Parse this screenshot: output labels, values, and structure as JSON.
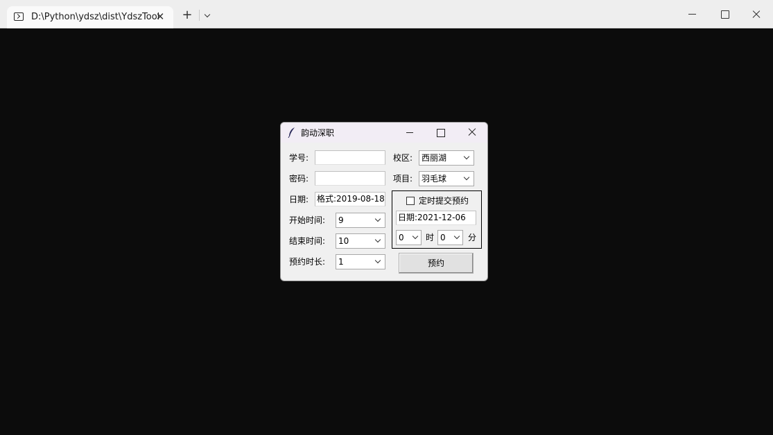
{
  "terminal": {
    "tab_title": "D:\\Python\\ydsz\\dist\\YdszTool",
    "tab_close": "✕",
    "new_tab": "+"
  },
  "dialog": {
    "title": "韵动深职",
    "student_id": {
      "label": "学号:",
      "value": ""
    },
    "password": {
      "label": "密码:",
      "value": ""
    },
    "date": {
      "label": "日期:",
      "value": "格式:2019-08-18"
    },
    "start_time": {
      "label": "开始时间:",
      "value": "9"
    },
    "end_time": {
      "label": "结束时间:",
      "value": "10"
    },
    "duration": {
      "label": "预约时长:",
      "value": "1"
    },
    "campus": {
      "label": "校区:",
      "value": "西丽湖"
    },
    "item": {
      "label": "项目:",
      "value": "羽毛球"
    },
    "timer": {
      "checkbox_label": "定时提交预约",
      "checked": false,
      "date_value": "日期:2021-12-06",
      "hour_value": "0",
      "hour_unit": "时",
      "minute_value": "0",
      "minute_unit": "分"
    },
    "reserve_button": "预约"
  }
}
